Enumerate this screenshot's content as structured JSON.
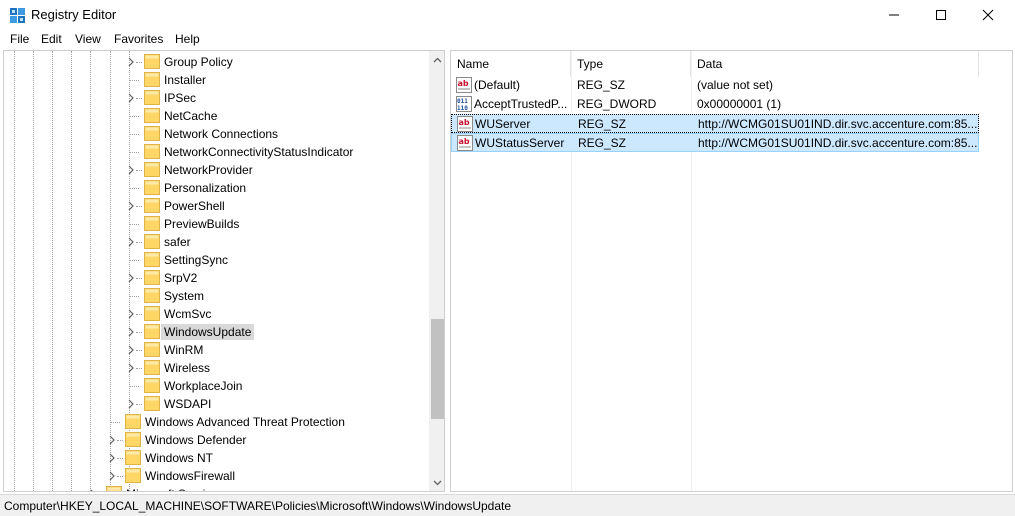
{
  "window": {
    "title": "Registry Editor",
    "icon": "registry-icon"
  },
  "menu": [
    "File",
    "Edit",
    "View",
    "Favorites",
    "Help"
  ],
  "tree": {
    "items": [
      {
        "label": "Group Policy",
        "level": 2,
        "expandable": true
      },
      {
        "label": "Installer",
        "level": 2,
        "expandable": false
      },
      {
        "label": "IPSec",
        "level": 2,
        "expandable": true
      },
      {
        "label": "NetCache",
        "level": 2,
        "expandable": false
      },
      {
        "label": "Network Connections",
        "level": 2,
        "expandable": false
      },
      {
        "label": "NetworkConnectivityStatusIndicator",
        "level": 2,
        "expandable": false
      },
      {
        "label": "NetworkProvider",
        "level": 2,
        "expandable": true
      },
      {
        "label": "Personalization",
        "level": 2,
        "expandable": false
      },
      {
        "label": "PowerShell",
        "level": 2,
        "expandable": true
      },
      {
        "label": "PreviewBuilds",
        "level": 2,
        "expandable": false
      },
      {
        "label": "safer",
        "level": 2,
        "expandable": true
      },
      {
        "label": "SettingSync",
        "level": 2,
        "expandable": false
      },
      {
        "label": "SrpV2",
        "level": 2,
        "expandable": true
      },
      {
        "label": "System",
        "level": 2,
        "expandable": false
      },
      {
        "label": "WcmSvc",
        "level": 2,
        "expandable": true
      },
      {
        "label": "WindowsUpdate",
        "level": 2,
        "expandable": true,
        "selected": true
      },
      {
        "label": "WinRM",
        "level": 2,
        "expandable": true
      },
      {
        "label": "Wireless",
        "level": 2,
        "expandable": true
      },
      {
        "label": "WorkplaceJoin",
        "level": 2,
        "expandable": false
      },
      {
        "label": "WSDAPI",
        "level": 2,
        "expandable": true
      },
      {
        "label": "Windows Advanced Threat Protection",
        "level": 1,
        "expandable": false
      },
      {
        "label": "Windows Defender",
        "level": 1,
        "expandable": true
      },
      {
        "label": "Windows NT",
        "level": 1,
        "expandable": true
      },
      {
        "label": "WindowsFirewall",
        "level": 1,
        "expandable": true
      },
      {
        "label": "Microsoft Services",
        "level": 0,
        "expandable": true
      }
    ]
  },
  "values": {
    "columns": [
      "Name",
      "Type",
      "Data"
    ],
    "rows": [
      {
        "name": "(Default)",
        "type": "REG_SZ",
        "data": "(value not set)",
        "icon": "string-value-icon"
      },
      {
        "name": "AcceptTrustedP...",
        "type": "REG_DWORD",
        "data": "0x00000001 (1)",
        "icon": "binary-value-icon"
      },
      {
        "name": "WUServer",
        "type": "REG_SZ",
        "data": "http://WCMG01SU01IND.dir.svc.accenture.com:85...",
        "icon": "string-value-icon",
        "selected": true,
        "focus": true
      },
      {
        "name": "WUStatusServer",
        "type": "REG_SZ",
        "data": "http://WCMG01SU01IND.dir.svc.accenture.com:85...",
        "icon": "string-value-icon",
        "selected": true
      }
    ]
  },
  "status": {
    "path": "Computer\\HKEY_LOCAL_MACHINE\\SOFTWARE\\Policies\\Microsoft\\Windows\\WindowsUpdate"
  },
  "colors": {
    "selection": "#cce8ff",
    "selection_border": "#99d1ff",
    "tree_selected": "#d9d9d9",
    "folder": "#ffd766"
  }
}
